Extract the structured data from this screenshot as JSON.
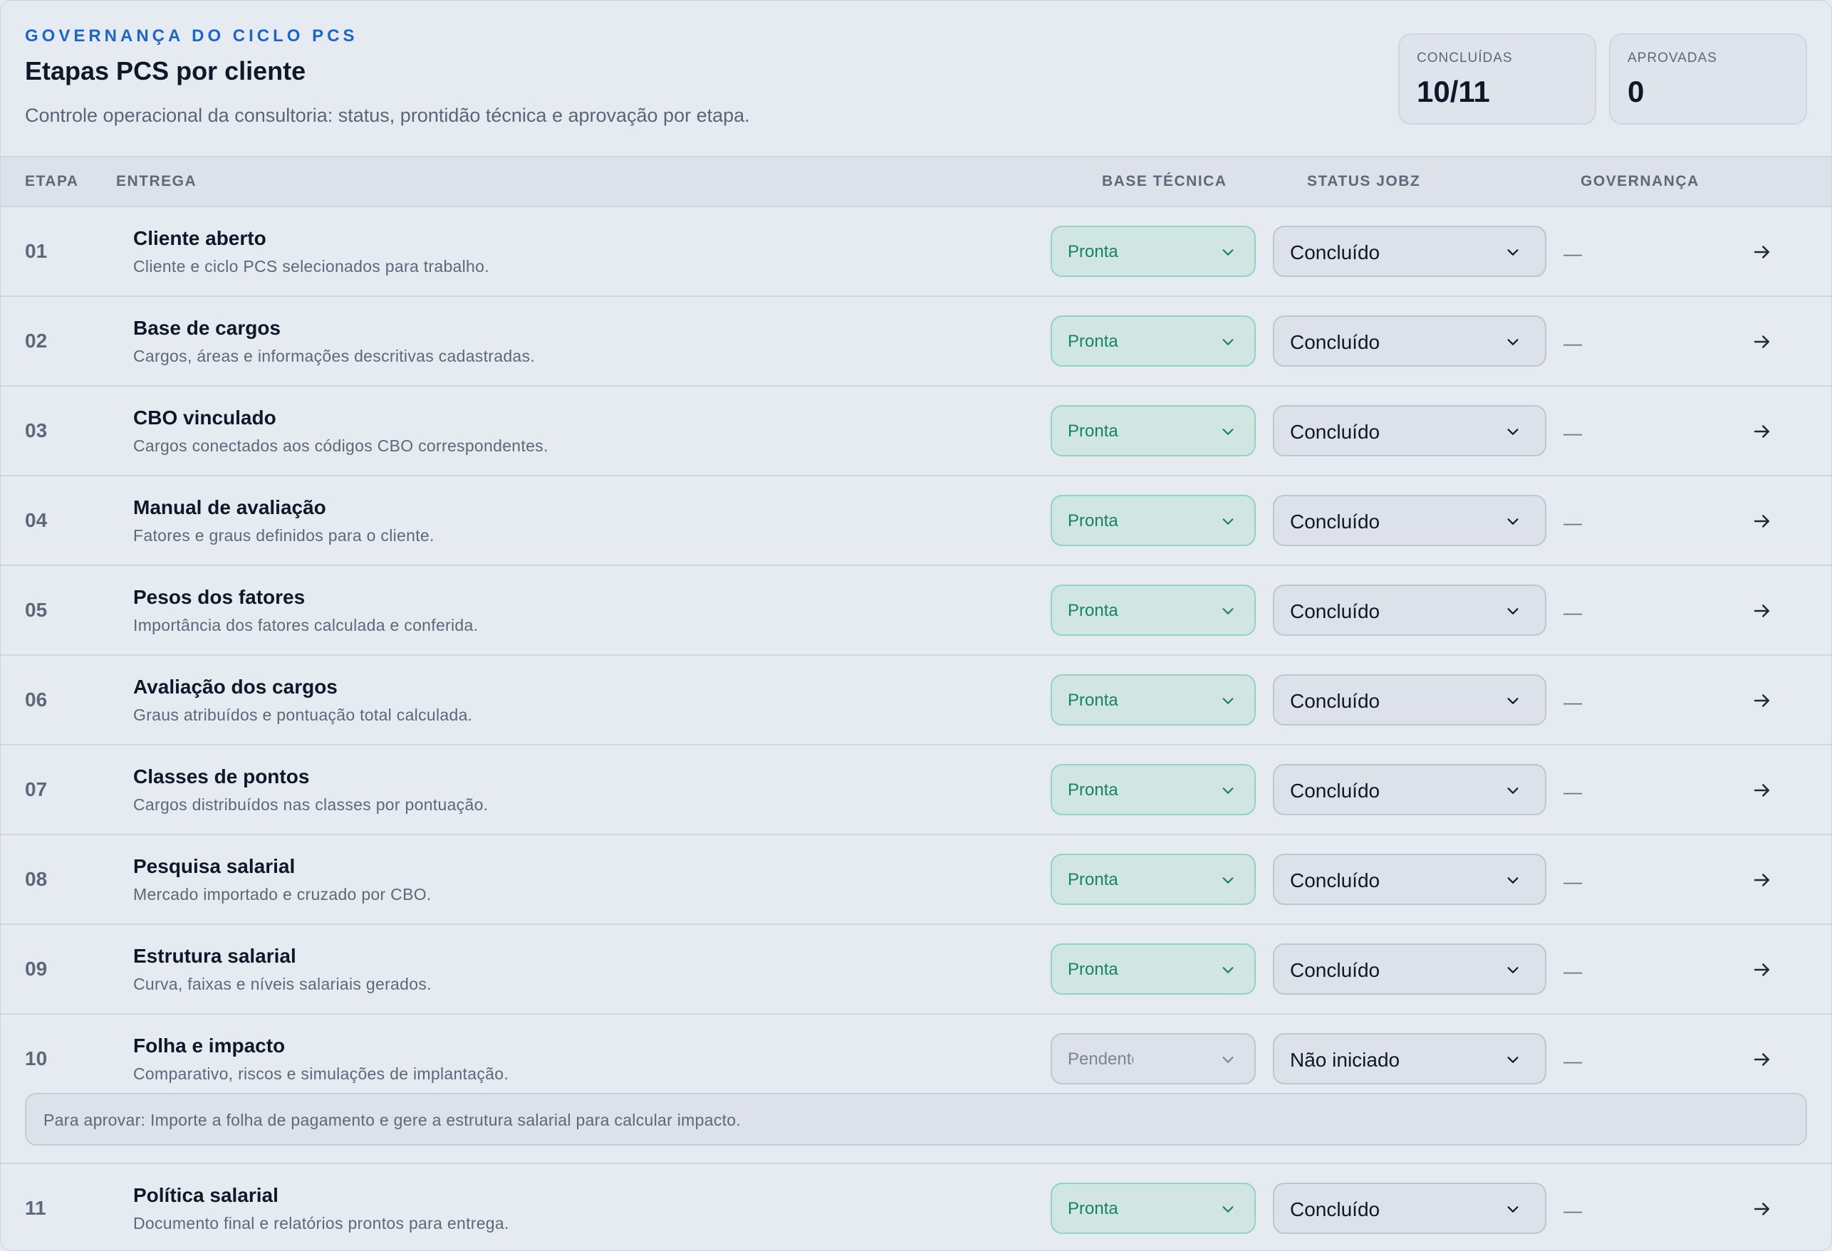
{
  "header": {
    "eyebrow": "GOVERNANÇA DO CICLO PCS",
    "title": "Etapas PCS por cliente",
    "subtitle": "Controle operacional da consultoria: status, prontidão técnica e aprovação por etapa.",
    "stats": [
      {
        "label": "CONCLUÍDAS",
        "value": "10/11"
      },
      {
        "label": "APROVADAS",
        "value": "0"
      }
    ]
  },
  "table": {
    "columns": {
      "etapa": "ETAPA",
      "entrega": "ENTREGA",
      "base_tecnica": "BASE TÉCNICA",
      "status_jobz": "STATUS JOBZ",
      "governanca": "GOVERNANÇA"
    },
    "rows": [
      {
        "num": "01",
        "name": "Cliente aberto",
        "desc": "Cliente e ciclo PCS selecionados para trabalho.",
        "tech": "Pronta",
        "status": "Concluído",
        "gov": "—"
      },
      {
        "num": "02",
        "name": "Base de cargos",
        "desc": "Cargos, áreas e informações descritivas cadastradas.",
        "tech": "Pronta",
        "status": "Concluído",
        "gov": "—"
      },
      {
        "num": "03",
        "name": "CBO vinculado",
        "desc": "Cargos conectados aos códigos CBO correspondentes.",
        "tech": "Pronta",
        "status": "Concluído",
        "gov": "—"
      },
      {
        "num": "04",
        "name": "Manual de avaliação",
        "desc": "Fatores e graus definidos para o cliente.",
        "tech": "Pronta",
        "status": "Concluído",
        "gov": "—"
      },
      {
        "num": "05",
        "name": "Pesos dos fatores",
        "desc": "Importância dos fatores calculada e conferida.",
        "tech": "Pronta",
        "status": "Concluído",
        "gov": "—"
      },
      {
        "num": "06",
        "name": "Avaliação dos cargos",
        "desc": "Graus atribuídos e pontuação total calculada.",
        "tech": "Pronta",
        "status": "Concluído",
        "gov": "—"
      },
      {
        "num": "07",
        "name": "Classes de pontos",
        "desc": "Cargos distribuídos nas classes por pontuação.",
        "tech": "Pronta",
        "status": "Concluído",
        "gov": "—"
      },
      {
        "num": "08",
        "name": "Pesquisa salarial",
        "desc": "Mercado importado e cruzado por CBO.",
        "tech": "Pronta",
        "status": "Concluído",
        "gov": "—"
      },
      {
        "num": "09",
        "name": "Estrutura salarial",
        "desc": "Curva, faixas e níveis salariais gerados.",
        "tech": "Pronta",
        "status": "Concluído",
        "gov": "—"
      },
      {
        "num": "10",
        "name": "Folha e impacto",
        "desc": "Comparativo, riscos e simulações de implantação.",
        "tech": "Pendente",
        "status": "Não iniciado",
        "gov": "—",
        "note": "Para aprovar: Importe a folha de pagamento e gere a estrutura salarial para calcular impacto."
      },
      {
        "num": "11",
        "name": "Política salarial",
        "desc": "Documento final e relatórios prontos para entrega.",
        "tech": "Pronta",
        "status": "Concluído",
        "gov": "—"
      }
    ]
  },
  "colors": {
    "accent": "#1b66c9",
    "ready_text": "#17845b",
    "ready_bg": "#d1e6e3",
    "ready_border": "#8fd6be"
  },
  "icons": {
    "select": "chevron-down-icon",
    "row_action": "arrow-right-icon"
  }
}
